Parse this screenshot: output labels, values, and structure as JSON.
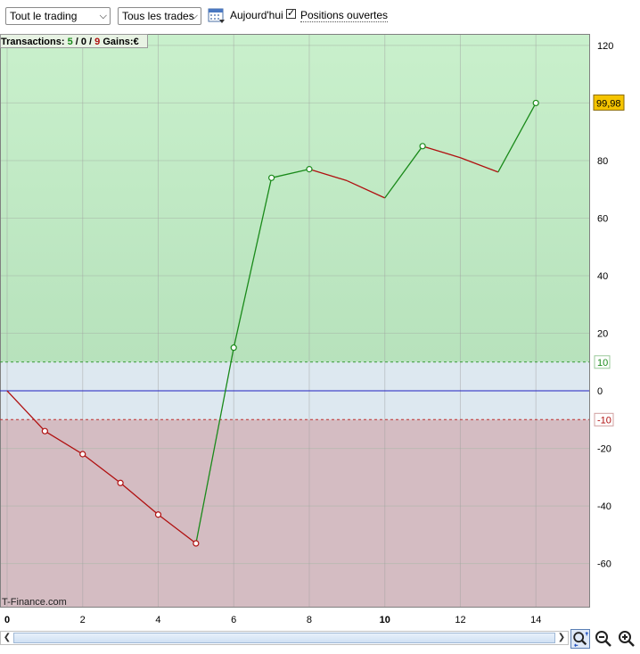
{
  "toolbar": {
    "trading_select": "Tout le trading",
    "trades_select": "Tous les trades",
    "today_label": "Aujourd'hui",
    "positions_checked": true,
    "positions_label": "Positions ouvertes",
    "calendar_icon": "calendar-icon",
    "chevron_icon": "chevron-down-icon"
  },
  "summary": {
    "transactions_label": "Transactions:",
    "win_count": "5",
    "sep1": " / ",
    "neutral_count": "0",
    "sep2": " / ",
    "loss_count": "9",
    "gains_label": "Gains:",
    "gains_value": "€"
  },
  "watermark": "T-Finance.com",
  "current_value_label": "99,98",
  "colors": {
    "profit_zone": "#c8efcb",
    "loss_zone": "#d4bcc2",
    "neutral_zone": "#dde8f0",
    "up_line": "#1a8a1a",
    "down_line": "#b01010",
    "zero_line": "#2020c0",
    "value_badge": "#f5c400"
  },
  "chart_data": {
    "type": "line",
    "x": [
      0,
      1,
      2,
      3,
      4,
      5,
      6,
      7,
      8,
      9,
      10,
      11,
      12,
      13,
      14
    ],
    "y": [
      0,
      -14,
      -22,
      -32,
      -43,
      -53,
      15,
      74,
      77,
      73,
      67,
      85,
      81,
      76,
      100
    ],
    "markers_at": [
      1,
      2,
      3,
      4,
      5,
      6,
      7,
      8,
      11,
      14
    ],
    "xlim": [
      0,
      15.6
    ],
    "ylim": [
      -75,
      124
    ],
    "x_ticks": [
      "0",
      "2",
      "4",
      "6",
      "8",
      "10",
      "12",
      "14"
    ],
    "y_ticks": [
      "120",
      "80",
      "60",
      "40",
      "20",
      "0",
      "-20",
      "-40",
      "-60"
    ],
    "zone_upper": 10,
    "zone_lower": -10,
    "zone_upper_label": "10",
    "zone_lower_label": "-10",
    "grid": true
  }
}
